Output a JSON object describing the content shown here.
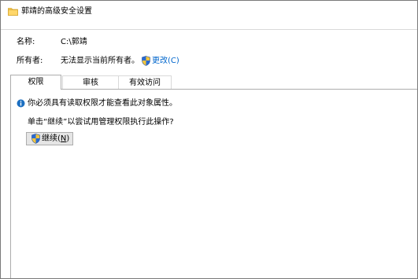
{
  "window": {
    "title": "郭靖的高级安全设置"
  },
  "properties": {
    "name_label": "名称:",
    "name_value": "C:\\郭靖",
    "owner_label": "所有者:",
    "owner_value": "无法显示当前所有者。",
    "change_link": "更改(C)"
  },
  "tabs": [
    {
      "label": "权限",
      "active": true
    },
    {
      "label": "审核",
      "active": false
    },
    {
      "label": "有效访问",
      "active": false
    }
  ],
  "panel": {
    "info_message": "你必须具有读取权限才能查看此对象属性。",
    "prompt_text": "单击“继续”以尝试用管理权限执行此操作?",
    "continue_button": {
      "label_main": "继续(",
      "accelerator": "N",
      "label_end": ")"
    }
  },
  "icons": {
    "folder": "folder-icon",
    "shield": "uac-shield-icon",
    "info": "info-icon"
  },
  "colors": {
    "link": "#0066cc",
    "info_icon": "#1c6fc1",
    "folder": "#f5c953"
  }
}
